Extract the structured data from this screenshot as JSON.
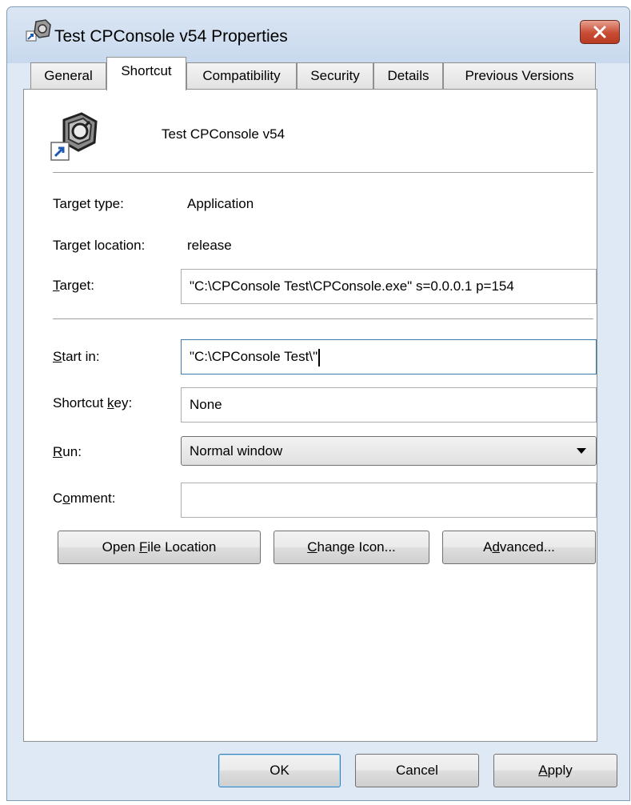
{
  "window": {
    "title": "Test CPConsole v54 Properties"
  },
  "tabs": [
    {
      "label": "General"
    },
    {
      "label": "Shortcut"
    },
    {
      "label": "Compatibility"
    },
    {
      "label": "Security"
    },
    {
      "label": "Details"
    },
    {
      "label": "Previous Versions"
    }
  ],
  "active_tab": "Shortcut",
  "shortcut": {
    "name": "Test CPConsole v54",
    "target_type_label": "Target type:",
    "target_type_value": "Application",
    "target_location_label": "Target location:",
    "target_location_value": "release",
    "target_label_key": "T",
    "target_label_rest": "arget:",
    "target_value": "\"C:\\CPConsole Test\\CPConsole.exe\" s=0.0.0.1 p=154",
    "start_in_label_key": "S",
    "start_in_label_rest": "tart in:",
    "start_in_value": "\"C:\\CPConsole Test\\\"",
    "shortcut_key_label_pre": "Shortcut ",
    "shortcut_key_label_key": "k",
    "shortcut_key_label_rest": "ey:",
    "shortcut_key_value": "None",
    "run_label_key": "R",
    "run_label_rest": "un:",
    "run_value": "Normal window",
    "comment_label_pre": "C",
    "comment_label_key": "o",
    "comment_label_rest": "mment:",
    "comment_value": ""
  },
  "buttons": {
    "open_file_location_pre": "Open ",
    "open_file_location_key": "F",
    "open_file_location_rest": "ile Location",
    "change_icon_key": "C",
    "change_icon_rest": "hange Icon...",
    "advanced_pre": "A",
    "advanced_key": "d",
    "advanced_rest": "vanced...",
    "ok": "OK",
    "cancel": "Cancel",
    "apply_key": "A",
    "apply_rest": "pply"
  },
  "colors": {
    "window_frame": "#dfe9f5",
    "close_button": "#c84b33",
    "focus_border": "#3d7bad"
  },
  "icons": [
    "shortcut-app-icon",
    "close-icon",
    "dropdown-arrow-icon",
    "shortcut-arrow-icon"
  ]
}
